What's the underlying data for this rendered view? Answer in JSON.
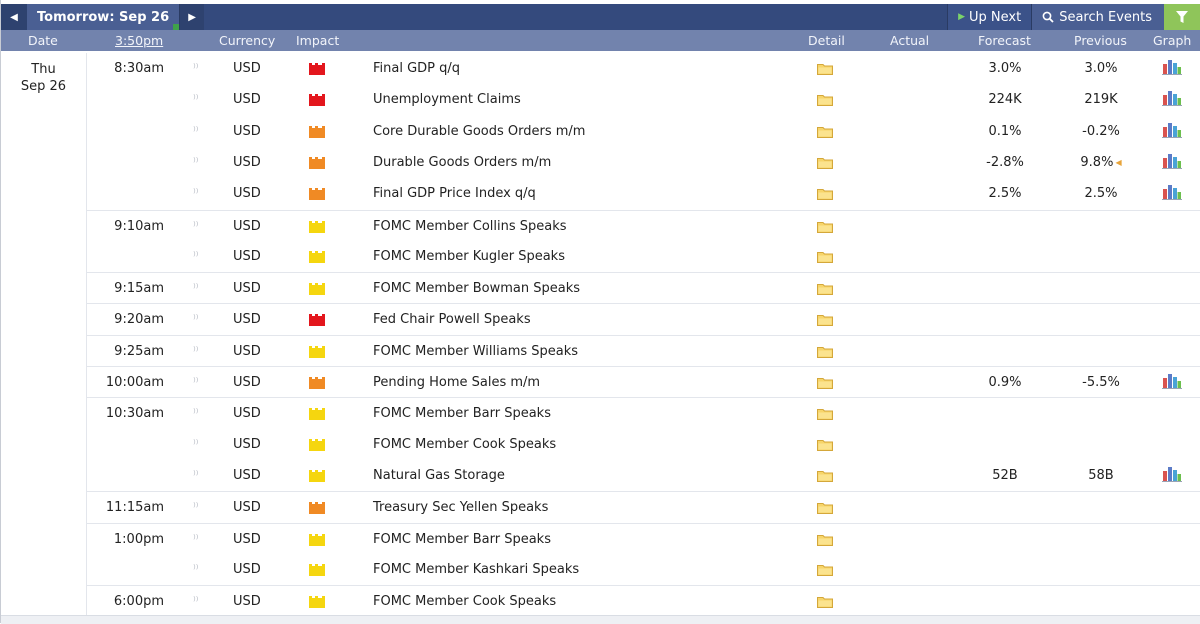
{
  "nav": {
    "date_tab": "Tomorrow: Sep 26",
    "up_next": "Up Next",
    "search": "Search Events"
  },
  "columns": {
    "date": "Date",
    "time": "3:50pm",
    "currency": "Currency",
    "impact": "Impact",
    "detail": "Detail",
    "actual": "Actual",
    "forecast": "Forecast",
    "previous": "Previous",
    "graph": "Graph"
  },
  "day": {
    "weekday": "Thu",
    "date": "Sep 26"
  },
  "impact_colors": {
    "high": "#e3161d",
    "medium": "#f08a24",
    "low": "#f5d60f"
  },
  "events": [
    {
      "time": "8:30am",
      "currency": "USD",
      "impact": "high",
      "event": "Final GDP q/q",
      "actual": "",
      "forecast": "3.0%",
      "previous": "3.0%",
      "revised": false,
      "graph": true
    },
    {
      "time": "",
      "currency": "USD",
      "impact": "high",
      "event": "Unemployment Claims",
      "actual": "",
      "forecast": "224K",
      "previous": "219K",
      "revised": false,
      "graph": true
    },
    {
      "time": "",
      "currency": "USD",
      "impact": "medium",
      "event": "Core Durable Goods Orders m/m",
      "actual": "",
      "forecast": "0.1%",
      "previous": "-0.2%",
      "revised": false,
      "graph": true
    },
    {
      "time": "",
      "currency": "USD",
      "impact": "medium",
      "event": "Durable Goods Orders m/m",
      "actual": "",
      "forecast": "-2.8%",
      "previous": "9.8%",
      "revised": true,
      "graph": true
    },
    {
      "time": "",
      "currency": "USD",
      "impact": "medium",
      "event": "Final GDP Price Index q/q",
      "actual": "",
      "forecast": "2.5%",
      "previous": "2.5%",
      "revised": false,
      "graph": true
    },
    {
      "time": "9:10am",
      "currency": "USD",
      "impact": "low",
      "event": "FOMC Member Collins Speaks",
      "actual": "",
      "forecast": "",
      "previous": "",
      "revised": false,
      "graph": false
    },
    {
      "time": "",
      "currency": "USD",
      "impact": "low",
      "event": "FOMC Member Kugler Speaks",
      "actual": "",
      "forecast": "",
      "previous": "",
      "revised": false,
      "graph": false
    },
    {
      "time": "9:15am",
      "currency": "USD",
      "impact": "low",
      "event": "FOMC Member Bowman Speaks",
      "actual": "",
      "forecast": "",
      "previous": "",
      "revised": false,
      "graph": false
    },
    {
      "time": "9:20am",
      "currency": "USD",
      "impact": "high",
      "event": "Fed Chair Powell Speaks",
      "actual": "",
      "forecast": "",
      "previous": "",
      "revised": false,
      "graph": false
    },
    {
      "time": "9:25am",
      "currency": "USD",
      "impact": "low",
      "event": "FOMC Member Williams Speaks",
      "actual": "",
      "forecast": "",
      "previous": "",
      "revised": false,
      "graph": false
    },
    {
      "time": "10:00am",
      "currency": "USD",
      "impact": "medium",
      "event": "Pending Home Sales m/m",
      "actual": "",
      "forecast": "0.9%",
      "previous": "-5.5%",
      "revised": false,
      "graph": true
    },
    {
      "time": "10:30am",
      "currency": "USD",
      "impact": "low",
      "event": "FOMC Member Barr Speaks",
      "actual": "",
      "forecast": "",
      "previous": "",
      "revised": false,
      "graph": false
    },
    {
      "time": "",
      "currency": "USD",
      "impact": "low",
      "event": "FOMC Member Cook Speaks",
      "actual": "",
      "forecast": "",
      "previous": "",
      "revised": false,
      "graph": false
    },
    {
      "time": "",
      "currency": "USD",
      "impact": "low",
      "event": "Natural Gas Storage",
      "actual": "",
      "forecast": "52B",
      "previous": "58B",
      "revised": false,
      "graph": true
    },
    {
      "time": "11:15am",
      "currency": "USD",
      "impact": "medium",
      "event": "Treasury Sec Yellen Speaks",
      "actual": "",
      "forecast": "",
      "previous": "",
      "revised": false,
      "graph": false
    },
    {
      "time": "1:00pm",
      "currency": "USD",
      "impact": "low",
      "event": "FOMC Member Barr Speaks",
      "actual": "",
      "forecast": "",
      "previous": "",
      "revised": false,
      "graph": false
    },
    {
      "time": "",
      "currency": "USD",
      "impact": "low",
      "event": "FOMC Member Kashkari Speaks",
      "actual": "",
      "forecast": "",
      "previous": "",
      "revised": false,
      "graph": false
    },
    {
      "time": "6:00pm",
      "currency": "USD",
      "impact": "low",
      "event": "FOMC Member Cook Speaks",
      "actual": "",
      "forecast": "",
      "previous": "",
      "revised": false,
      "graph": false
    }
  ]
}
